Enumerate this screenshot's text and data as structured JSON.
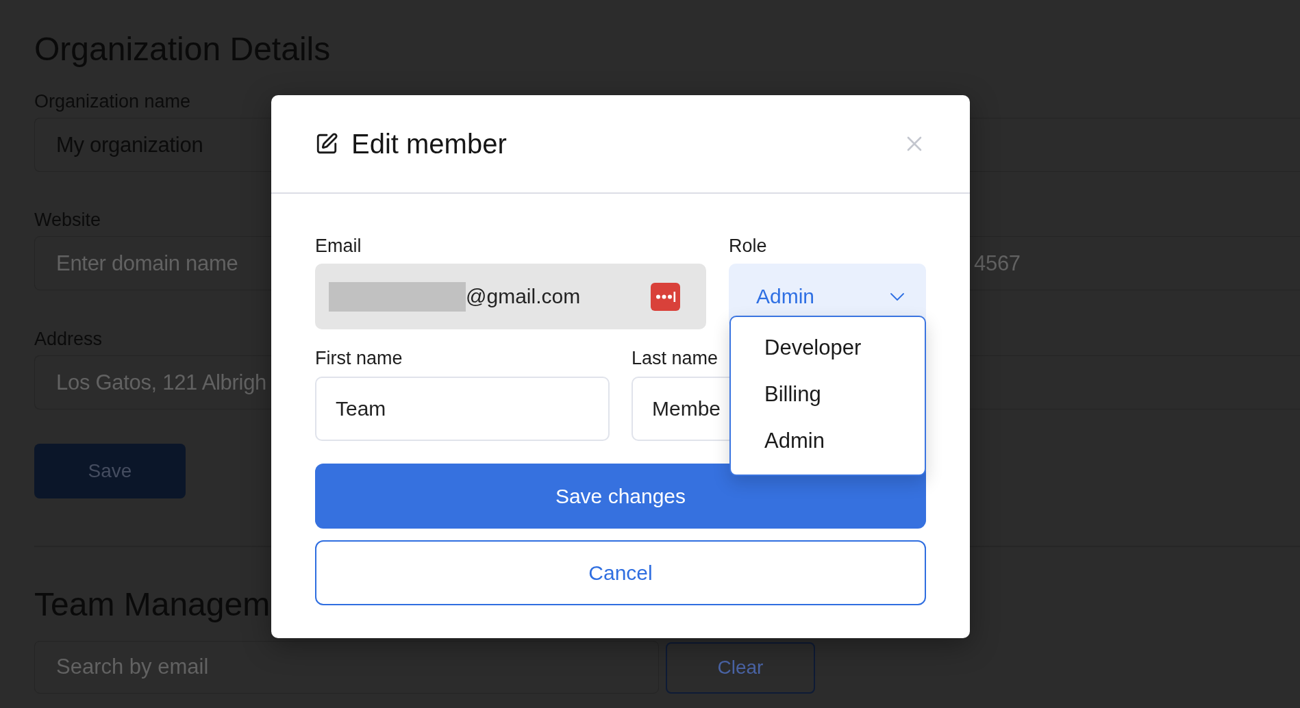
{
  "organization_details": {
    "title": "Organization Details",
    "rows": [
      [
        {
          "label": "Organization name",
          "value": "My organization"
        }
      ],
      [
        {
          "label": "Website",
          "placeholder": "Enter domain name"
        },
        {
          "placeholder": "4567"
        }
      ],
      [
        {
          "label": "Address",
          "placeholder": "Los Gatos, 121 Albrigh"
        }
      ]
    ],
    "save_button": "Save"
  },
  "team_management": {
    "title": "Team Managem",
    "search": {
      "placeholder": "Search by email"
    },
    "clear_button": "Clear"
  },
  "dialog": {
    "title": "Edit member",
    "email": {
      "label": "Email",
      "value": "@gmail.com",
      "redacted": true
    },
    "role": {
      "label": "Role",
      "value": "Admin",
      "expanded": true,
      "options": [
        "Developer",
        "Billing",
        "Admin"
      ]
    },
    "first_name": {
      "label": "First name",
      "value": "Team"
    },
    "last_name": {
      "label": "Last name",
      "value": "Membe"
    },
    "buttons": [
      {
        "label": "Save changes",
        "kind": "primary"
      },
      {
        "label": "Cancel",
        "kind": "secondary"
      }
    ]
  }
}
